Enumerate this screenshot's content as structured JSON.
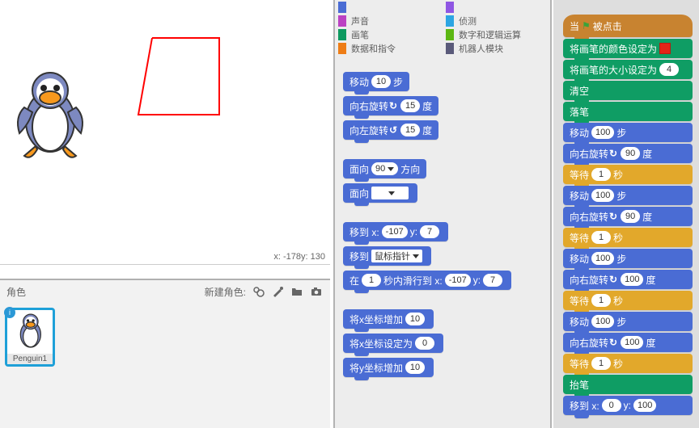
{
  "stage": {
    "coords_label": "x: -178y: 130"
  },
  "sprite_panel": {
    "label": "角色",
    "new_label": "新建角色:",
    "thumb_name": "Penguin1"
  },
  "categories": [
    {
      "color": "#4a6cd4",
      "label": ""
    },
    {
      "color": "#8f56e3",
      "label": ""
    },
    {
      "color": "#bb42c3",
      "label": "声音"
    },
    {
      "color": "#2ca5e2",
      "label": "侦测"
    },
    {
      "color": "#0e9a60",
      "label": "画笔"
    },
    {
      "color": "#5cb712",
      "label": "数字和逻辑运算"
    },
    {
      "color": "#ee7d16",
      "label": "数据和指令"
    },
    {
      "color": "#5a5a7a",
      "label": "机器人模块"
    }
  ],
  "palette_blocks": {
    "move": {
      "pre": "移动",
      "val": "10",
      "post": "步"
    },
    "turn_r": {
      "pre": "向右旋转",
      "arrow": "↻",
      "val": "15",
      "post": "度"
    },
    "turn_l": {
      "pre": "向左旋转",
      "arrow": "↺",
      "val": "15",
      "post": "度"
    },
    "face_dir": {
      "pre": "面向",
      "val": "90",
      "post": "方向"
    },
    "face_obj": {
      "pre": "面向"
    },
    "goto_xy": {
      "pre": "移到 x:",
      "x": "-107",
      "mid": "y:",
      "y": "7"
    },
    "goto_obj": {
      "pre": "移到",
      "target": "鼠标指针"
    },
    "glide": {
      "pre": "在",
      "secs": "1",
      "mid1": "秒内滑行到 x:",
      "x": "-107",
      "mid2": "y:",
      "y": "7"
    },
    "change_x": {
      "pre": "将x坐标增加",
      "val": "10"
    },
    "set_x": {
      "pre": "将x坐标设定为",
      "val": "0"
    },
    "change_y": {
      "pre": "将y坐标增加",
      "val": "10"
    }
  },
  "script": {
    "hat": {
      "pre": "当",
      "post": "被点击"
    },
    "pen_color": {
      "pre": "将画笔的颜色设定为"
    },
    "pen_size": {
      "pre": "将画笔的大小设定为",
      "val": "4"
    },
    "clear": "清空",
    "pendown": "落笔",
    "move100": {
      "pre": "移动",
      "val": "100",
      "post": "步"
    },
    "turn90": {
      "pre": "向右旋转",
      "arrow": "↻",
      "val": "90",
      "post": "度"
    },
    "turn100": {
      "pre": "向右旋转",
      "arrow": "↻",
      "val": "100",
      "post": "度"
    },
    "wait1": {
      "pre": "等待",
      "val": "1",
      "post": "秒"
    },
    "penup": "抬笔",
    "gotoxy": {
      "pre": "移到 x:",
      "x": "0",
      "mid": "y:",
      "y": "100"
    }
  }
}
